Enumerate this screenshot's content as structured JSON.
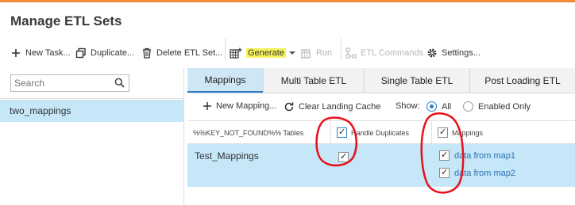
{
  "title": "Manage ETL Sets",
  "toolbar": {
    "new_task": "New Task...",
    "duplicate": "Duplicate...",
    "delete": "Delete ETL Set...",
    "generate": "Generate",
    "run": "Run",
    "etl_commands": "ETL Commands",
    "settings": "Settings..."
  },
  "search": {
    "placeholder": "Search"
  },
  "etl_sets": [
    {
      "label": "two_mappings"
    }
  ],
  "tabs": [
    {
      "label": "Mappings",
      "active": true
    },
    {
      "label": "Multi Table ETL"
    },
    {
      "label": "Single Table ETL"
    },
    {
      "label": "Post Loading ETL"
    }
  ],
  "subtoolbar": {
    "new_mapping": "New Mapping...",
    "clear_cache": "Clear Landing Cache",
    "show_label": "Show:",
    "show_all": "All",
    "show_enabled": "Enabled Only",
    "selected": "All"
  },
  "grid": {
    "headers": {
      "tables": "%%KEY_NOT_FOUND%% Tables",
      "handle_duplicates": "Handle Duplicates",
      "mappings": "Mappings"
    },
    "rows": [
      {
        "table": "Test_Mappings",
        "handle_duplicates": true,
        "mappings": [
          {
            "label": "data from map1",
            "checked": true
          },
          {
            "label": "data from map2",
            "checked": true
          }
        ]
      }
    ]
  },
  "colors": {
    "accent_top": "#f08a3c",
    "selection": "#c5e7f7",
    "highlight": "#f7f45a",
    "annotation_red": "#e8101a",
    "link_blue": "#2e6fb0"
  }
}
